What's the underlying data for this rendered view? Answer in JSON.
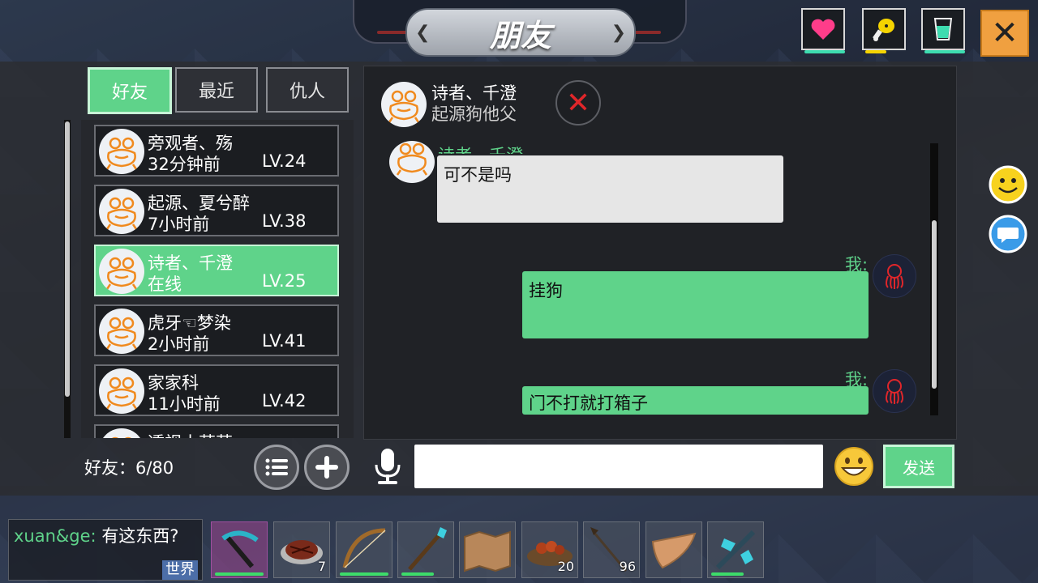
{
  "title": "朋友",
  "tabs": [
    {
      "label": "好友",
      "active": true
    },
    {
      "label": "最近",
      "active": false
    },
    {
      "label": "仇人",
      "active": false
    }
  ],
  "friends": [
    {
      "name": "旁观者、殇",
      "status": "32分钟前",
      "level": "LV.24",
      "selected": false
    },
    {
      "name": "起源、夏兮醉",
      "status": "7小时前",
      "level": "LV.38",
      "selected": false
    },
    {
      "name": "诗者、千澄",
      "status": "在线",
      "level": "LV.25",
      "selected": true
    },
    {
      "name": "虎牙☜梦染",
      "status": "2小时前",
      "level": "LV.41",
      "selected": false
    },
    {
      "name": "家家科",
      "status": "11小时前",
      "level": "LV.42",
      "selected": false
    },
    {
      "name": "透视小萌萌",
      "status": "",
      "level": "",
      "selected": false
    }
  ],
  "friend_count": "好友：6/80",
  "chat": {
    "name": "诗者、千澄",
    "subtitle": "起源狗他父",
    "partial_sender": "诗者、千澄",
    "me_label": "我:",
    "messages": [
      {
        "from": "them",
        "text": "可不是吗"
      },
      {
        "from": "me",
        "text": "挂狗"
      },
      {
        "from": "me",
        "text": "门不打就打箱子"
      }
    ]
  },
  "input": {
    "value": "",
    "placeholder": ""
  },
  "send_label": "发送",
  "world_chat": {
    "sender": "xuan&ge",
    "separator": ":",
    "message": "有这东西?",
    "channel": "世界"
  },
  "hotbar": [
    {
      "item": "pickaxe",
      "count": ""
    },
    {
      "item": "steak",
      "count": "7"
    },
    {
      "item": "bow",
      "count": ""
    },
    {
      "item": "crystal-spear",
      "count": ""
    },
    {
      "item": "map",
      "count": ""
    },
    {
      "item": "cooked-meat-plate",
      "count": "20"
    },
    {
      "item": "arrow",
      "count": "96"
    },
    {
      "item": "wooden-boat",
      "count": ""
    },
    {
      "item": "crystal-crossbow",
      "count": ""
    }
  ],
  "colors": {
    "accent": "#5fd38a",
    "close": "#f0a040",
    "danger": "#e0262a",
    "health": "#ff3d8a",
    "hunger": "#f5d400",
    "thirst": "#3ddcb0"
  }
}
